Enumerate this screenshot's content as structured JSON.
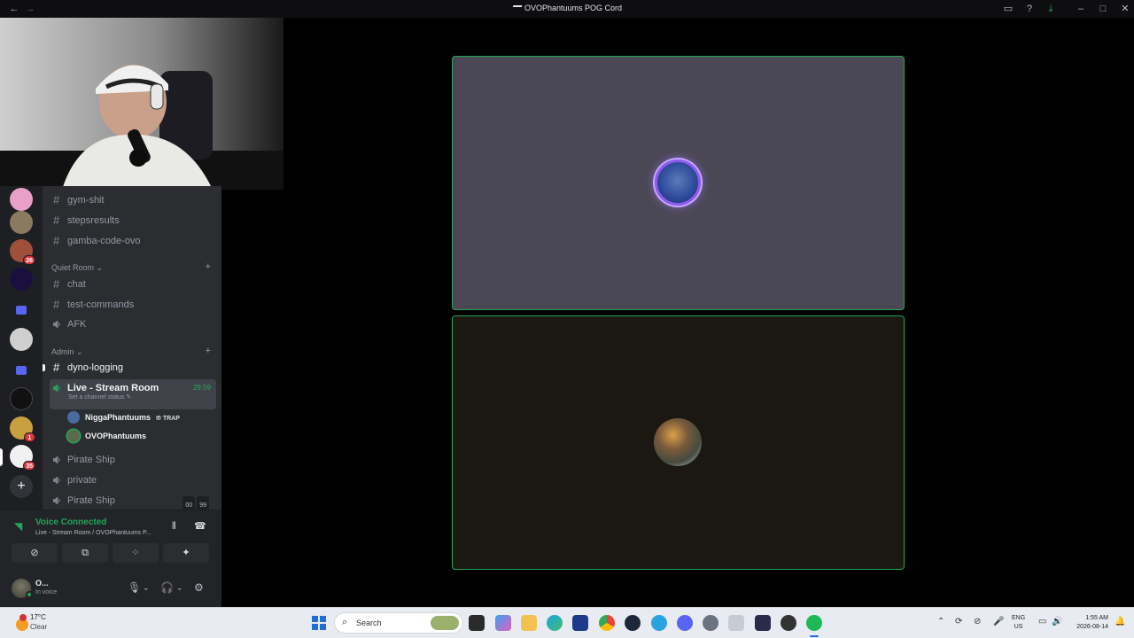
{
  "window": {
    "title": "OVOPhantuums POG Cord"
  },
  "sidebar": {
    "channels_top": [
      {
        "label": "gym-shit"
      },
      {
        "label": "stepsresults"
      },
      {
        "label": "gamba-code-ovo"
      }
    ],
    "categories": [
      {
        "name": "Quiet Room",
        "channels": [
          {
            "label": "chat"
          },
          {
            "label": "test-commands"
          },
          {
            "label": "AFK"
          }
        ]
      },
      {
        "name": "Admin",
        "channels": [
          {
            "label": "dyno-logging"
          }
        ]
      }
    ],
    "active_voice": {
      "label": "Live - Stream Room",
      "timer": "29:59",
      "status_placeholder": "Set a channel status",
      "users": [
        {
          "name": "NiggaPhantuums",
          "tag": "TRAP"
        },
        {
          "name": "OVOPhantuums"
        }
      ]
    },
    "voice_channels": [
      {
        "label": "Pirate Ship"
      },
      {
        "label": "private"
      },
      {
        "label": "Pirate Ship",
        "counts": [
          "00",
          "99"
        ]
      }
    ],
    "server_badges": [
      "26",
      "1",
      "35"
    ]
  },
  "voice_panel": {
    "status": "Voice Connected",
    "channel": "Live - Stream Room / OVOPhantuums P..."
  },
  "user_panel": {
    "name": "O...",
    "status": "In voice"
  },
  "taskbar": {
    "weather_temp": "17°C",
    "weather_cond": "Clear",
    "search_label": "Search",
    "ime_top": "ENG",
    "ime_bottom": "US",
    "time": "1:55 AM",
    "date": "2026-08-14"
  },
  "colors": {
    "speaking_green": "#23a55a",
    "accent_purple": "#8c5bf0",
    "badge_red": "#da373c"
  }
}
